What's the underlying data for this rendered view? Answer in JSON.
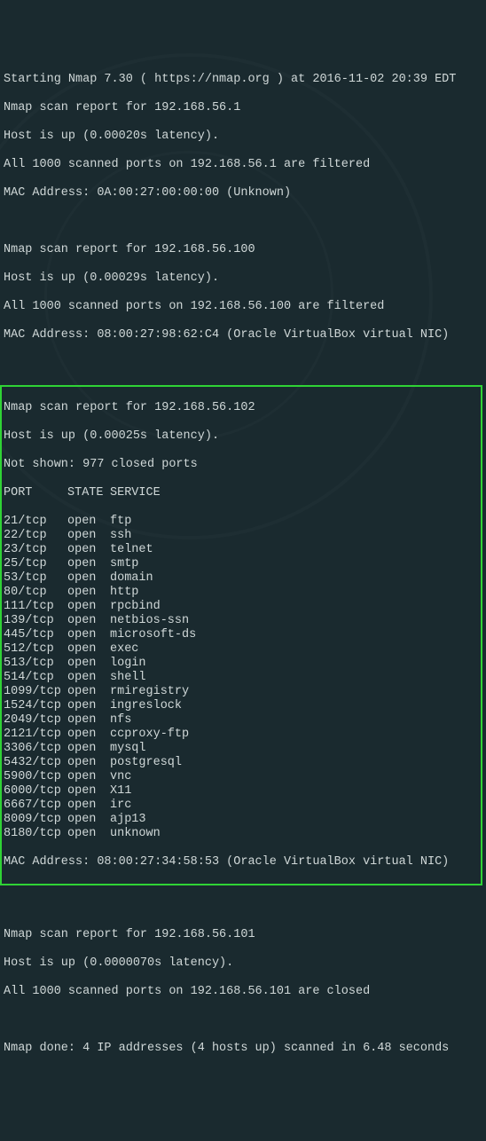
{
  "intro": {
    "starting": "Starting Nmap 7.30 ( https://nmap.org ) at 2016-11-02 20:39 EDT"
  },
  "host1": {
    "report": "Nmap scan report for 192.168.56.1",
    "up": "Host is up (0.00020s latency).",
    "filtered": "All 1000 scanned ports on 192.168.56.1 are filtered",
    "mac": "MAC Address: 0A:00:27:00:00:00 (Unknown)"
  },
  "host2": {
    "report": "Nmap scan report for 192.168.56.100",
    "up": "Host is up (0.00029s latency).",
    "filtered": "All 1000 scanned ports on 192.168.56.100 are filtered",
    "mac": "MAC Address: 08:00:27:98:62:C4 (Oracle VirtualBox virtual NIC)"
  },
  "host3": {
    "report": "Nmap scan report for 192.168.56.102",
    "up": "Host is up (0.00025s latency).",
    "notshown": "Not shown: 977 closed ports",
    "header": {
      "port": "PORT",
      "state": "STATE",
      "service": "SERVICE"
    },
    "ports": [
      {
        "port": "21/tcp",
        "state": "open",
        "service": "ftp"
      },
      {
        "port": "22/tcp",
        "state": "open",
        "service": "ssh"
      },
      {
        "port": "23/tcp",
        "state": "open",
        "service": "telnet"
      },
      {
        "port": "25/tcp",
        "state": "open",
        "service": "smtp"
      },
      {
        "port": "53/tcp",
        "state": "open",
        "service": "domain"
      },
      {
        "port": "80/tcp",
        "state": "open",
        "service": "http"
      },
      {
        "port": "111/tcp",
        "state": "open",
        "service": "rpcbind"
      },
      {
        "port": "139/tcp",
        "state": "open",
        "service": "netbios-ssn"
      },
      {
        "port": "445/tcp",
        "state": "open",
        "service": "microsoft-ds"
      },
      {
        "port": "512/tcp",
        "state": "open",
        "service": "exec"
      },
      {
        "port": "513/tcp",
        "state": "open",
        "service": "login"
      },
      {
        "port": "514/tcp",
        "state": "open",
        "service": "shell"
      },
      {
        "port": "1099/tcp",
        "state": "open",
        "service": "rmiregistry"
      },
      {
        "port": "1524/tcp",
        "state": "open",
        "service": "ingreslock"
      },
      {
        "port": "2049/tcp",
        "state": "open",
        "service": "nfs"
      },
      {
        "port": "2121/tcp",
        "state": "open",
        "service": "ccproxy-ftp"
      },
      {
        "port": "3306/tcp",
        "state": "open",
        "service": "mysql"
      },
      {
        "port": "5432/tcp",
        "state": "open",
        "service": "postgresql"
      },
      {
        "port": "5900/tcp",
        "state": "open",
        "service": "vnc"
      },
      {
        "port": "6000/tcp",
        "state": "open",
        "service": "X11"
      },
      {
        "port": "6667/tcp",
        "state": "open",
        "service": "irc"
      },
      {
        "port": "8009/tcp",
        "state": "open",
        "service": "ajp13"
      },
      {
        "port": "8180/tcp",
        "state": "open",
        "service": "unknown"
      }
    ],
    "mac": "MAC Address: 08:00:27:34:58:53 (Oracle VirtualBox virtual NIC)"
  },
  "host4": {
    "report": "Nmap scan report for 192.168.56.101",
    "up": "Host is up (0.0000070s latency).",
    "closed": "All 1000 scanned ports on 192.168.56.101 are closed"
  },
  "footer": {
    "done": "Nmap done: 4 IP addresses (4 hosts up) scanned in 6.48 seconds"
  }
}
